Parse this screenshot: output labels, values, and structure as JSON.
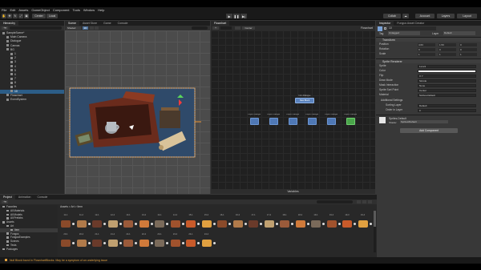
{
  "menu": [
    "File",
    "Edit",
    "Assets",
    "GameObject",
    "Component",
    "Tools",
    "Window",
    "Help"
  ],
  "toolbar": {
    "account": "Account",
    "layers": "Layers",
    "layout": "Layout",
    "collab": "Collab",
    "center": "Center",
    "local": "Local",
    "play_icons": [
      "▶",
      "❚❚",
      "▶|"
    ]
  },
  "hierarchy": {
    "tabs": [
      "Hierarchy"
    ],
    "rows": [
      {
        "label": "SampleScene*",
        "indent": 0,
        "selected": false
      },
      {
        "label": "Main Camera",
        "indent": 1,
        "selected": false
      },
      {
        "label": "Dialogue",
        "indent": 1,
        "selected": false
      },
      {
        "label": "Canvas",
        "indent": 1,
        "selected": false
      },
      {
        "label": "BG",
        "indent": 1,
        "selected": false
      },
      {
        "label": "1",
        "indent": 2,
        "selected": false
      },
      {
        "label": "2",
        "indent": 2,
        "selected": false
      },
      {
        "label": "3",
        "indent": 2,
        "selected": false
      },
      {
        "label": "4",
        "indent": 2,
        "selected": false
      },
      {
        "label": "5",
        "indent": 2,
        "selected": false
      },
      {
        "label": "6",
        "indent": 2,
        "selected": false
      },
      {
        "label": "7",
        "indent": 2,
        "selected": false
      },
      {
        "label": "8",
        "indent": 2,
        "selected": false
      },
      {
        "label": "9",
        "indent": 2,
        "selected": false
      },
      {
        "label": "10",
        "indent": 2,
        "selected": true
      },
      {
        "label": "Flowchart",
        "indent": 1,
        "selected": false
      },
      {
        "label": "EventSystem",
        "indent": 1,
        "selected": false
      }
    ]
  },
  "scene": {
    "tabs": [
      "Scene",
      "Asset Store",
      "Game",
      "Console"
    ],
    "shaded": "Shaded",
    "view_2d": "2D"
  },
  "flowchart": {
    "tabs": [
      "Flowchart"
    ],
    "toolbar": [
      "+",
      "Center"
    ],
    "right_label": "Flowchart",
    "top_node": {
      "title": "Intro Dialogue",
      "button": "New Block"
    },
    "nodes": [
      {
        "title": "Object Dialogue"
      },
      {
        "title": "Object Dialogue"
      },
      {
        "title": "Object Dialogue"
      },
      {
        "title": "Object Dialogue"
      },
      {
        "title": "Object Dialogue"
      },
      {
        "title": "Object Dialogue"
      }
    ],
    "variables": "Variables"
  },
  "inspector": {
    "tabs": [
      "Inspector",
      "Fungus Asset Creator"
    ],
    "object_name": "10",
    "tag_label": "Tag",
    "tag_value": "Untagged",
    "layer_label": "Layer",
    "layer_value": "Default",
    "transform": {
      "header": "Transform",
      "position": {
        "label": "Position",
        "x": "4.63",
        "y": "1.53",
        "z": "0"
      },
      "rotation": {
        "label": "Rotation",
        "x": "0",
        "y": "0",
        "z": "0"
      },
      "scale": {
        "label": "Scale",
        "x": "1",
        "y": "1",
        "z": "1"
      }
    },
    "sprite_renderer": {
      "header": "Sprite Renderer",
      "rows": [
        {
          "label": "Sprite",
          "value": "1x1x3"
        },
        {
          "label": "Color",
          "value": ""
        },
        {
          "label": "Flip",
          "value": "X  Y"
        },
        {
          "label": "Draw Mode",
          "value": "Simple"
        },
        {
          "label": "Mask Interaction",
          "value": "None"
        },
        {
          "label": "Sprite Sort Point",
          "value": "Center"
        },
        {
          "label": "Material",
          "value": "Sprites-Default"
        }
      ],
      "additional": "Additional Settings",
      "sorting_layer": {
        "label": "Sorting Layer",
        "value": "Default"
      },
      "order_in_layer": {
        "label": "Order in Layer",
        "value": "0"
      }
    },
    "material": {
      "name": "Sprites-Default",
      "shader_label": "Shader",
      "shader_value": "Sprites/Default"
    },
    "add_component": "Add Component"
  },
  "project": {
    "tabs": [
      "Project",
      "Animation",
      "Console"
    ],
    "breadcrumb": "Assets > Art > Item",
    "tree": [
      {
        "label": "Favorites",
        "indent": 0
      },
      {
        "label": "All Materials",
        "indent": 1
      },
      {
        "label": "All Models",
        "indent": 1
      },
      {
        "label": "All Prefabs",
        "indent": 1
      },
      {
        "label": "Assets",
        "indent": 0
      },
      {
        "label": "Art",
        "indent": 1
      },
      {
        "label": "Item",
        "indent": 2
      },
      {
        "label": "Fungus",
        "indent": 1
      },
      {
        "label": "FungusExamples",
        "indent": 1
      },
      {
        "label": "Scenes",
        "indent": 1
      },
      {
        "label": "Tests",
        "indent": 1
      },
      {
        "label": "Packages",
        "indent": 0
      }
    ],
    "assets_row1": [
      "11-1",
      "11-2",
      "12-1",
      "12-2",
      "13-1",
      "13-2",
      "14-1",
      "14-2",
      "15-1",
      "15-2",
      "16-1",
      "16-2",
      "17-1",
      "17-2",
      "18-1",
      "18-2",
      "19-1",
      "19-2",
      "19-3",
      "19-4"
    ],
    "assets_row2": [
      "20-1",
      "20-2",
      "21-1",
      "21-2",
      "22-1",
      "22-2",
      "23-1",
      "23-2",
      "24-1",
      "24-2"
    ]
  },
  "status": "Null Block found in FlowchartBlocks. May be a symptom of an underlying issue"
}
